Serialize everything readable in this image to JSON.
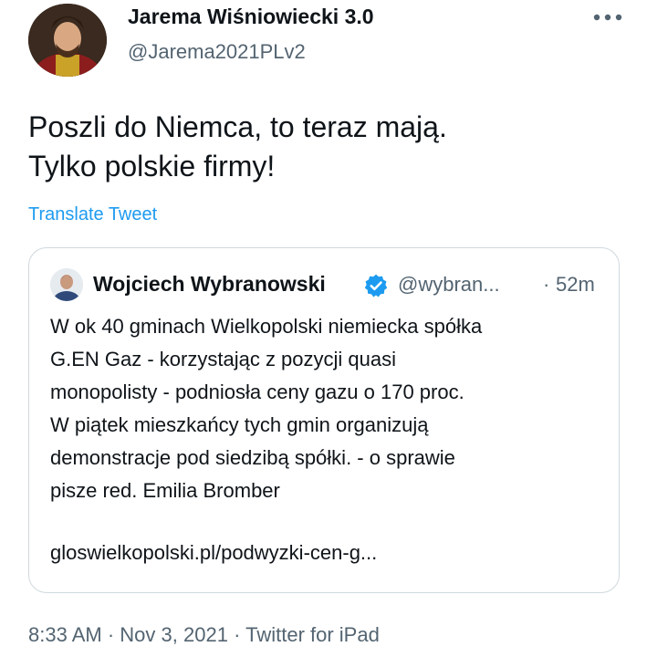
{
  "tweet": {
    "author_name": "Jarema Wiśniowiecki 3.0",
    "author_handle": "@Jarema2021PLv2",
    "text": "Poszli do Niemca, to teraz mają.\nTylko polskie firmy!",
    "translate_label": "Translate Tweet",
    "more_icon": "more-horizontal-icon"
  },
  "quoted": {
    "author_name": "Wojciech Wybranowski",
    "verified_icon": "verified-badge-icon",
    "author_handle": "@wybran...",
    "separator": "·",
    "time_ago": "52m",
    "text": "W ok 40 gminach Wielkopolski niemiecka spółka\nG.EN Gaz - korzystając z pozycji quasi\nmonopolisty - podniosła ceny gazu o 170 proc.\nW piątek mieszkańcy tych gmin organizują\ndemonstracje pod siedzibą spółki. - o sprawie\npisze red. Emilia Bromber",
    "link": "gloswielkopolski.pl/podwyzki-cen-g..."
  },
  "meta": {
    "time": "8:33 AM",
    "dot1": "·",
    "date": "Nov 3, 2021",
    "dot2": "·",
    "source": "Twitter for iPad"
  },
  "colors": {
    "link": "#1d9bf0",
    "secondary_text": "#536471",
    "border": "#cfd9de",
    "verified": "#1d9bf0"
  }
}
